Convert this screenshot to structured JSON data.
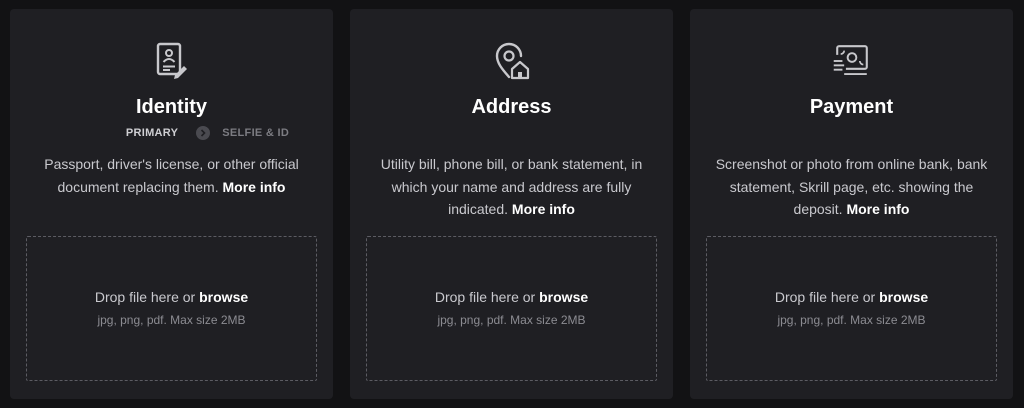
{
  "cards": [
    {
      "icon": "id-document-icon",
      "title": "Identity",
      "steps": {
        "primary": "PRIMARY",
        "secondary": "SELFIE & ID"
      },
      "description": "Passport, driver's license, or other official document replacing them.",
      "more_info": "More info",
      "drop": {
        "text": "Drop file here or",
        "browse": "browse",
        "hint": "jpg, png, pdf. Max size 2MB"
      }
    },
    {
      "icon": "location-home-icon",
      "title": "Address",
      "description": "Utility bill, phone bill, or bank statement, in which your name and address are fully indicated.",
      "more_info": "More info",
      "drop": {
        "text": "Drop file here or",
        "browse": "browse",
        "hint": "jpg, png, pdf. Max size 2MB"
      }
    },
    {
      "icon": "payment-card-icon",
      "title": "Payment",
      "description": "Screenshot or photo from online bank, bank statement, Skrill page, etc. showing the deposit.",
      "more_info": "More info",
      "drop": {
        "text": "Drop file here or",
        "browse": "browse",
        "hint": "jpg, png, pdf. Max size 2MB"
      }
    }
  ],
  "colors": {
    "background": "#121214",
    "card": "#1f1f23",
    "text": "#c9c9ce",
    "heading": "#ffffff"
  }
}
